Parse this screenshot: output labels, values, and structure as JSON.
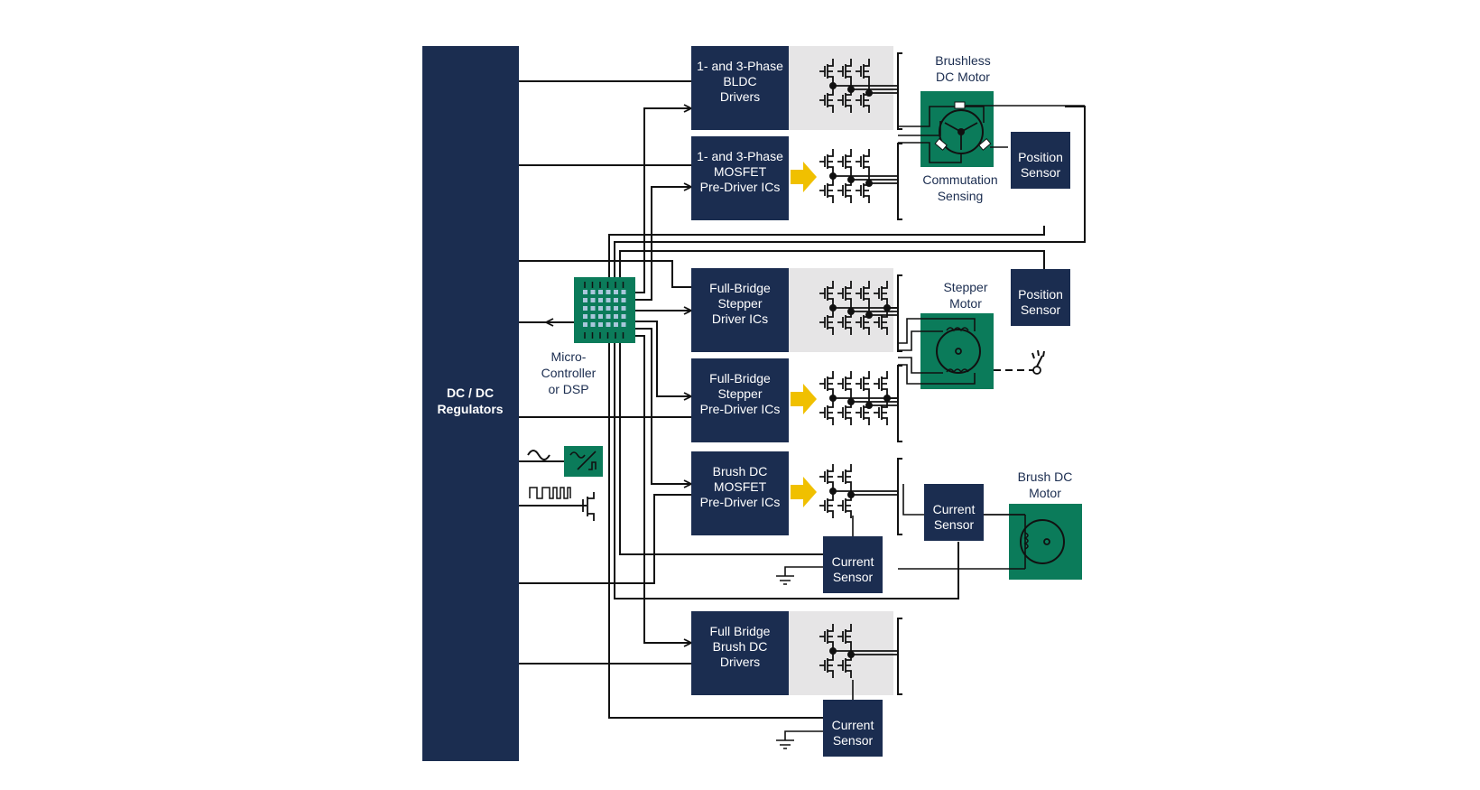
{
  "regulator": {
    "line1": "DC / DC",
    "line2": "Regulators"
  },
  "microcontroller": {
    "line1": "Micro-",
    "line2": "Controller",
    "line3": "or DSP"
  },
  "blocks": [
    {
      "id": "bldc-drivers",
      "lines": [
        "1- and 3-Phase",
        "BLDC",
        "Drivers"
      ],
      "integrated": true
    },
    {
      "id": "bldc-predrivers",
      "lines": [
        "1- and 3-Phase",
        "MOSFET",
        "Pre-Driver ICs"
      ],
      "integrated": false
    },
    {
      "id": "stepper-drivers",
      "lines": [
        "Full-Bridge",
        "Stepper",
        "Driver ICs"
      ],
      "integrated": true
    },
    {
      "id": "stepper-predrivers",
      "lines": [
        "Full-Bridge",
        "Stepper",
        "Pre-Driver ICs"
      ],
      "integrated": false
    },
    {
      "id": "brushdc-predrivers",
      "lines": [
        "Brush DC",
        "MOSFET",
        "Pre-Driver ICs"
      ],
      "integrated": false
    },
    {
      "id": "fullbridge-brushdc",
      "lines": [
        "Full Bridge",
        "Brush DC",
        "Drivers"
      ],
      "integrated": true
    }
  ],
  "motors": {
    "brushless": {
      "line1": "Brushless",
      "line2": "DC Motor",
      "caption1": "Commutation",
      "caption2": "Sensing"
    },
    "stepper": {
      "line1": "Stepper",
      "line2": "Motor"
    },
    "brushdc": {
      "line1": "Brush DC",
      "line2": "Motor"
    }
  },
  "sensors": {
    "position1": {
      "line1": "Position",
      "line2": "Sensor"
    },
    "position2": {
      "line1": "Position",
      "line2": "Sensor"
    },
    "current1": {
      "line1": "Current",
      "line2": "Sensor"
    },
    "current2": {
      "line1": "Current",
      "line2": "Sensor"
    },
    "current3": {
      "line1": "Current",
      "line2": "Sensor"
    }
  },
  "colors": {
    "navy": "#1b2d50",
    "green": "#0b7b5a",
    "yellow": "#f0c000",
    "grey": "#e6e5e6"
  }
}
